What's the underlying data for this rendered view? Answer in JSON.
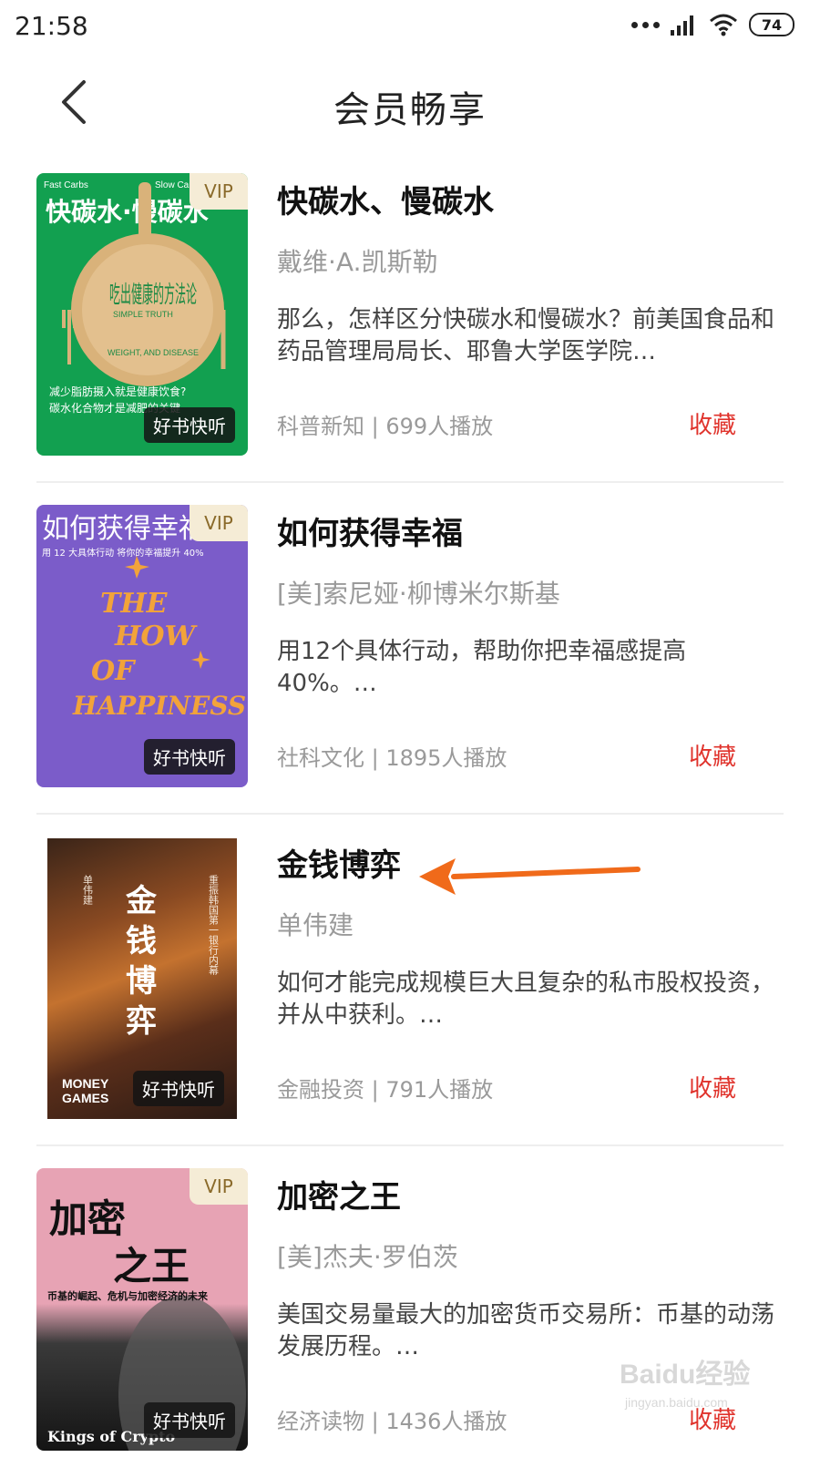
{
  "status_bar": {
    "time": "21:58",
    "battery": "74"
  },
  "header": {
    "title": "会员畅享"
  },
  "items": [
    {
      "title": "快碳水、慢碳水",
      "author": "戴维·A.凯斯勒",
      "desc": "那么，怎样区分快碳水和慢碳水？前美国食品和药品管理局局长、耶鲁大学医学院…",
      "meta": "科普新知 | 699人播放",
      "collect": "收藏",
      "vip": "VIP",
      "badge": "好书快听",
      "cover": {
        "top_left": "Fast Carbs",
        "top_right": "Slow Carbs",
        "title": "快碳水·慢碳水",
        "plate_text": "吃出健康的方法论",
        "plate_en1": "SIMPLE TRUTH",
        "plate_en2": "WEIGHT, AND DISEASE",
        "tagline1": "减少脂肪摄入就是健康饮食?",
        "tagline2": "碳水化合物才是减肥的关键",
        "bg": "#12a050"
      }
    },
    {
      "title": "如何获得幸福",
      "author": "[美]索尼娅·柳博米尔斯基",
      "desc": "用12个具体行动，帮助你把幸福感提高40%。…",
      "meta": "社科文化 | 1895人播放",
      "collect": "收藏",
      "vip": "VIP",
      "badge": "好书快听",
      "cover": {
        "title": "如何获得幸福",
        "subtitle": "用 12 大具体行动    将你的幸福提升 40%",
        "art1": "THE",
        "art2": "HOW",
        "art3": "OF",
        "art4": "HAPPINESS",
        "bg": "#7b5cc9"
      }
    },
    {
      "title": "金钱博弈",
      "author": "单伟建",
      "desc": "如何才能完成规模巨大且复杂的私市股权投资，并从中获利。…",
      "meta": "金融投资 | 791人播放",
      "collect": "收藏",
      "badge": "好书快听",
      "cover": {
        "title_chars": [
          "金",
          "钱",
          "博",
          "弈"
        ],
        "side": "重振韩国第一银行内幕",
        "author": "单伟建",
        "en1": "MONEY",
        "en2": "GAMES"
      }
    },
    {
      "title": "加密之王",
      "author": "[美]杰夫·罗伯茨",
      "desc": "美国交易量最大的加密货币交易所：币基的动荡发展历程。…",
      "meta": "经济读物 | 1436人播放",
      "collect": "收藏",
      "vip": "VIP",
      "badge": "好书快听",
      "cover": {
        "title1": "加密",
        "title2": "之王",
        "subtitle": "币基的崛起、危机与加密经济的未来",
        "en": "Kings of Crypto",
        "bg": "#e7a3b4"
      }
    }
  ],
  "annotation": {
    "arrow_color": "#f06a1a"
  },
  "watermark": {
    "text": "Baidu经验",
    "url": "jingyan.baidu.com"
  }
}
